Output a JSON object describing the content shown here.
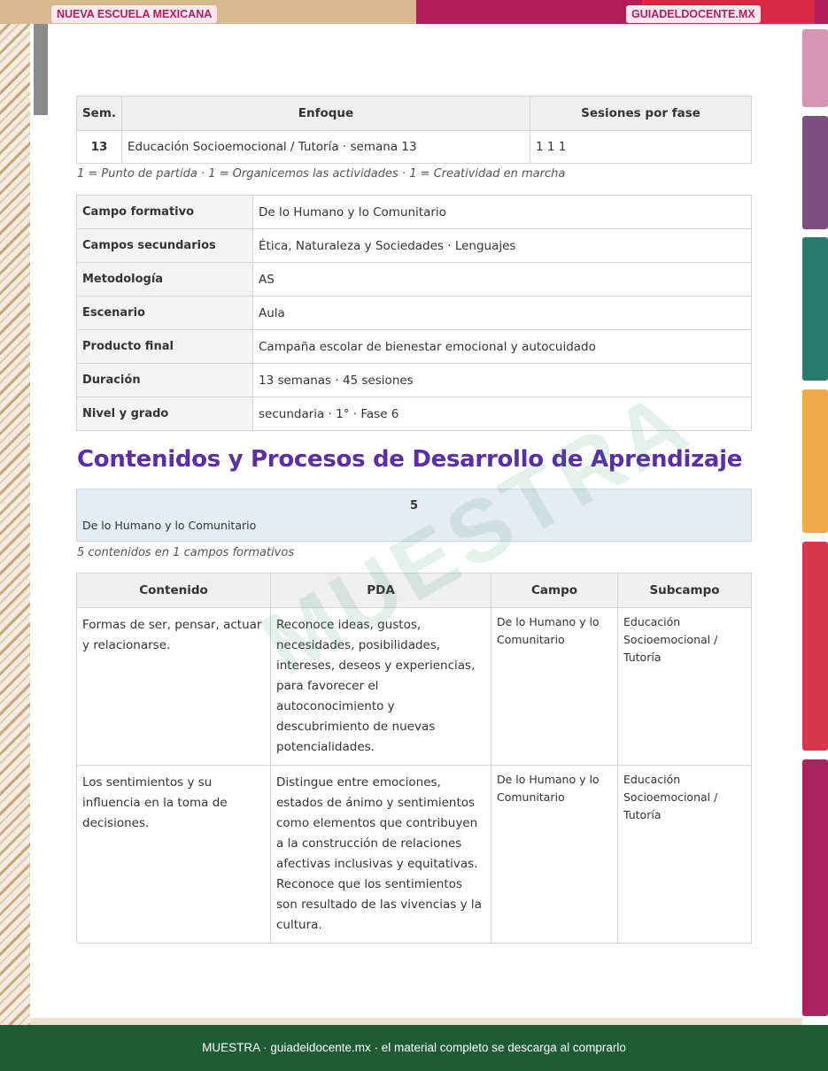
{
  "header": {
    "left_badge": "NUEVA ESCUELA MEXICANA",
    "right_badge": "GUIADELDOCENTE.MX"
  },
  "summary": {
    "headers": [
      "Sem.",
      "Enfoque",
      "Sesiones por fase"
    ],
    "row": {
      "sem": "13",
      "enfoque": "Educación Socioemocional / Tutoría · semana 13",
      "sesiones": "1 1 1"
    },
    "note": "1 = Punto de partida · 1 = Organicemos las actividades · 1 = Creatividad en marcha"
  },
  "details": [
    {
      "key": "Campo formativo",
      "value": "De lo Humano y lo Comunitario"
    },
    {
      "key": "Campos secundarios",
      "value": "Ética, Naturaleza y Sociedades · Lenguajes"
    },
    {
      "key": "Metodología",
      "value": "AS"
    },
    {
      "key": "Escenario",
      "value": "Aula"
    },
    {
      "key": "Producto final",
      "value": "Campaña escolar de bienestar emocional y autocuidado"
    },
    {
      "key": "Duración",
      "value": "13 semanas · 45 sesiones"
    },
    {
      "key": "Nivel y grado",
      "value": "secundaria · 1° · Fase 6"
    }
  ],
  "section": {
    "title": "Contenidos y Procesos de Desarrollo de Aprendizaje",
    "campo_count": "5",
    "campo_name": "De lo Humano y lo Comunitario",
    "note": "5 contenidos en 1 campos formativos"
  },
  "contents": {
    "headers": [
      "Contenido",
      "PDA",
      "Campo",
      "Subcampo"
    ],
    "rows": [
      {
        "contenido": "Formas de ser, pensar, actuar y relacionarse.",
        "pda": "Reconoce ideas, gustos, necesidades, posibilidades, intereses, deseos y experiencias, para favorecer el autoconocimiento y descubrimiento de nuevas potencialidades.",
        "campo": "De lo Humano y lo Comunitario",
        "subcampo": "Educación Socioemocional / Tutoría"
      },
      {
        "contenido": "Los sentimientos y su influencia en la toma de decisiones.",
        "pda": "Distingue entre emociones, estados de ánimo y sentimientos como elementos que contribuyen a la construcción de relaciones afectivas inclusivas y equitativas. Reconoce que los sentimientos son resultado de las vivencias y la cultura.",
        "campo": "De lo Humano y lo Comunitario",
        "subcampo": "Educación Socioemocional / Tutoría"
      }
    ]
  },
  "watermark": "MUESTRA",
  "footer": {
    "text": "MUESTRA · guiadeldocente.mx · el material completo se descarga al comprarlo"
  }
}
